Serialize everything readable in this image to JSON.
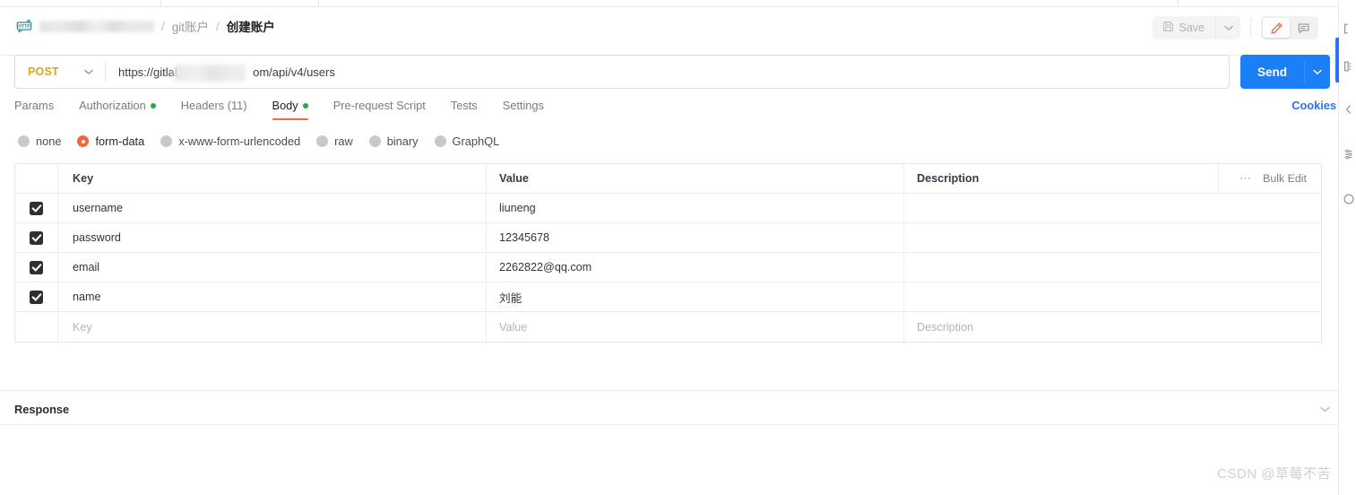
{
  "header": {
    "breadcrumb": {
      "workspace_redacted": "",
      "folder": "git账户",
      "separator": "/",
      "current": "创建账户"
    },
    "protocol_icon": "http-icon",
    "save_label": "Save",
    "save_caret_icon": "chevron-down-icon",
    "edit_mode_icon": "pencil-icon",
    "comment_mode_icon": "comment-icon"
  },
  "request": {
    "method": "POST",
    "method_caret_icon": "chevron-down-icon",
    "url": "https://gitlab",
    "url_suffix": "om/api/v4/users",
    "send_label": "Send",
    "send_caret_icon": "chevron-down-icon"
  },
  "tabs": [
    {
      "label": "Params",
      "dot": false,
      "active": false
    },
    {
      "label": "Authorization",
      "dot": true,
      "active": false
    },
    {
      "label": "Headers (11)",
      "dot": false,
      "active": false
    },
    {
      "label": "Body",
      "dot": true,
      "active": true
    },
    {
      "label": "Pre-request Script",
      "dot": false,
      "active": false
    },
    {
      "label": "Tests",
      "dot": false,
      "active": false
    },
    {
      "label": "Settings",
      "dot": false,
      "active": false
    }
  ],
  "cookies_label": "Cookies",
  "body_types": [
    {
      "label": "none",
      "selected": false
    },
    {
      "label": "form-data",
      "selected": true
    },
    {
      "label": "x-www-form-urlencoded",
      "selected": false
    },
    {
      "label": "raw",
      "selected": false
    },
    {
      "label": "binary",
      "selected": false
    },
    {
      "label": "GraphQL",
      "selected": false
    }
  ],
  "table": {
    "columns": {
      "key": "Key",
      "value": "Value",
      "description": "Description"
    },
    "bulk_edit_label": "Bulk Edit",
    "more_icon": "ellipsis-icon",
    "rows": [
      {
        "checked": true,
        "key": "username",
        "value": "liuneng",
        "description": ""
      },
      {
        "checked": true,
        "key": "password",
        "value": "12345678",
        "description": ""
      },
      {
        "checked": true,
        "key": "email",
        "value": "2262822@qq.com",
        "description": ""
      },
      {
        "checked": true,
        "key": "name",
        "value": "刘能",
        "description": ""
      }
    ],
    "placeholder_row": {
      "key": "Key",
      "value": "Value",
      "description": "Description"
    }
  },
  "response": {
    "title": "Response",
    "collapse_icon": "chevron-down-icon"
  },
  "right_rail": [
    {
      "icon": "code-brackets-icon"
    },
    {
      "icon": "layers-icon"
    },
    {
      "icon": "chevron-left-icon"
    },
    {
      "icon": "settings-sliders-icon"
    },
    {
      "icon": "info-circle-icon"
    }
  ],
  "watermark": "CSDN @草莓不苦",
  "colors": {
    "accent_orange": "#f26b3a",
    "method_amber": "#d8a818",
    "send_blue": "#1b7ff5",
    "link_blue": "#2f70f3",
    "dot_green": "#28a745"
  }
}
